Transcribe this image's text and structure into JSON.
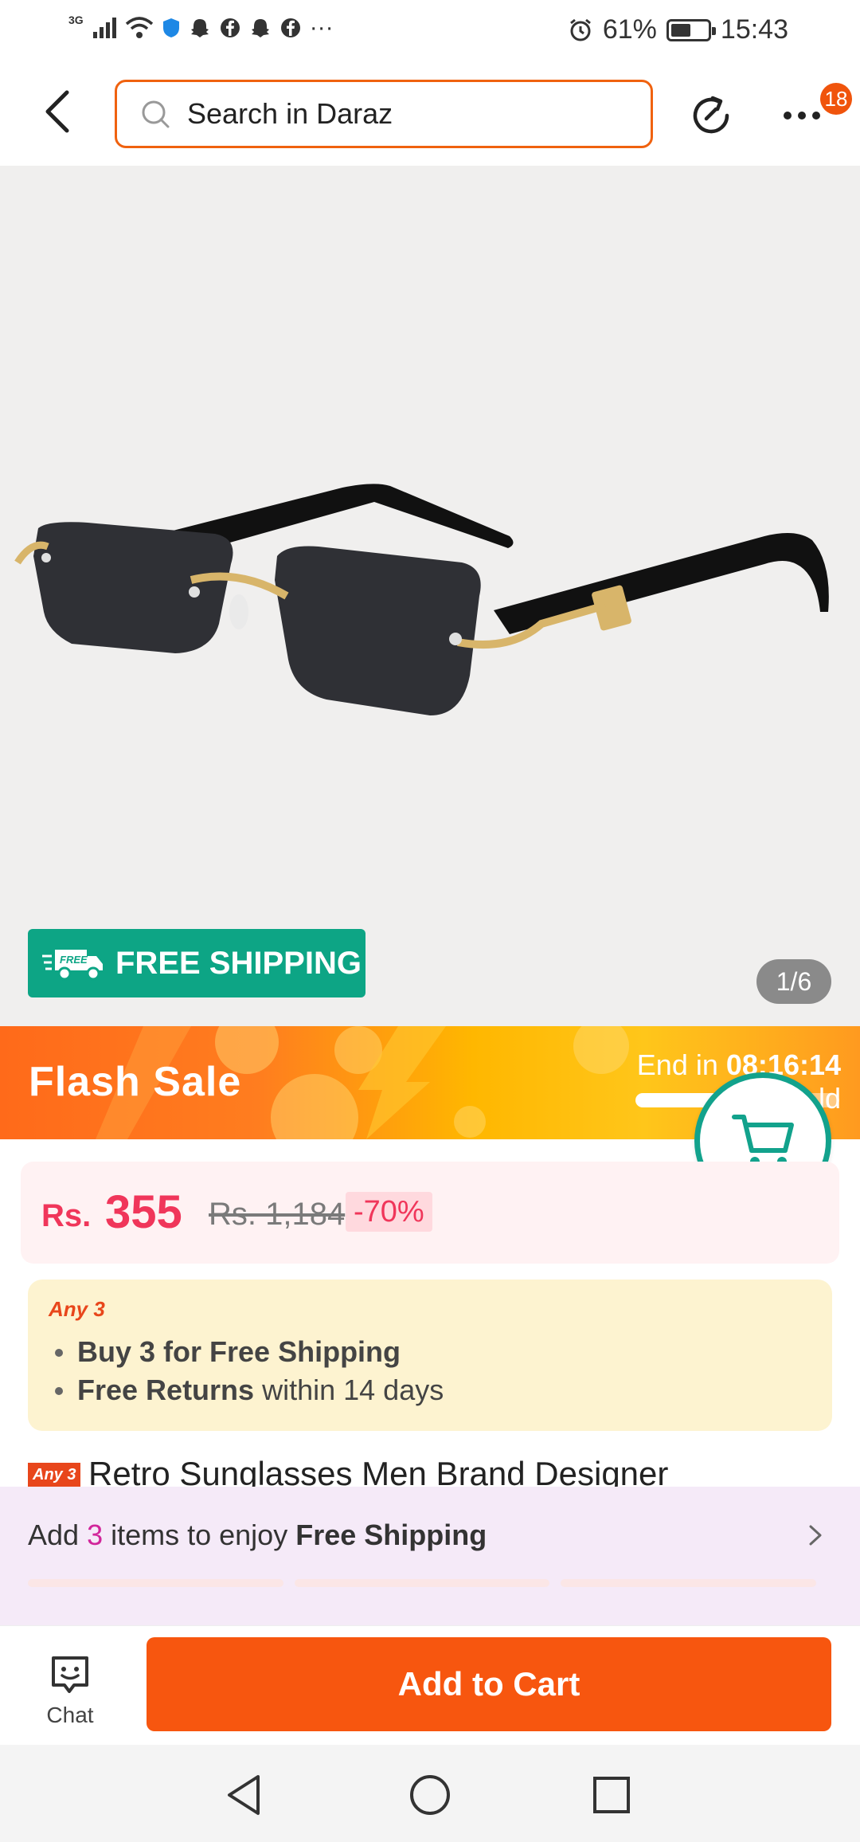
{
  "status_bar": {
    "network": "3G",
    "battery": "61%",
    "battery_level": 0.61,
    "time": "15:43",
    "more_indicator": "···"
  },
  "top_nav": {
    "search_placeholder": "Search in Daraz",
    "badge_count": "18"
  },
  "product_image": {
    "free_shipping_label": "FREE SHIPPING",
    "free_icon_label": "FREE",
    "counter": "1/6"
  },
  "flash_sale": {
    "title": "Flash Sale",
    "end_label": "End in",
    "countdown": "08:16:14",
    "sold_label": "ld",
    "progress": 0.6
  },
  "price": {
    "prefix": "Rs.",
    "current": "355",
    "original": "Rs. 1,184",
    "discount": "-70%"
  },
  "promo": {
    "tag": "Any 3",
    "line1_bold": "Buy 3 for  Free Shipping",
    "line2_bold": "Free Returns",
    "line2_rest": " within 14 days"
  },
  "product_title": {
    "tag": "Any 3",
    "text": "Retro Sunglasses Men Brand Designer"
  },
  "add_banner": {
    "prefix": "Add ",
    "count": "3",
    "middle": " items to enjoy ",
    "bold": "Free Shipping"
  },
  "bottom_bar": {
    "chat_label": "Chat",
    "add_to_cart_label": "Add to Cart"
  },
  "colors": {
    "brand_orange": "#f7560f",
    "price_red": "#f0365a",
    "teal": "#0da585"
  }
}
